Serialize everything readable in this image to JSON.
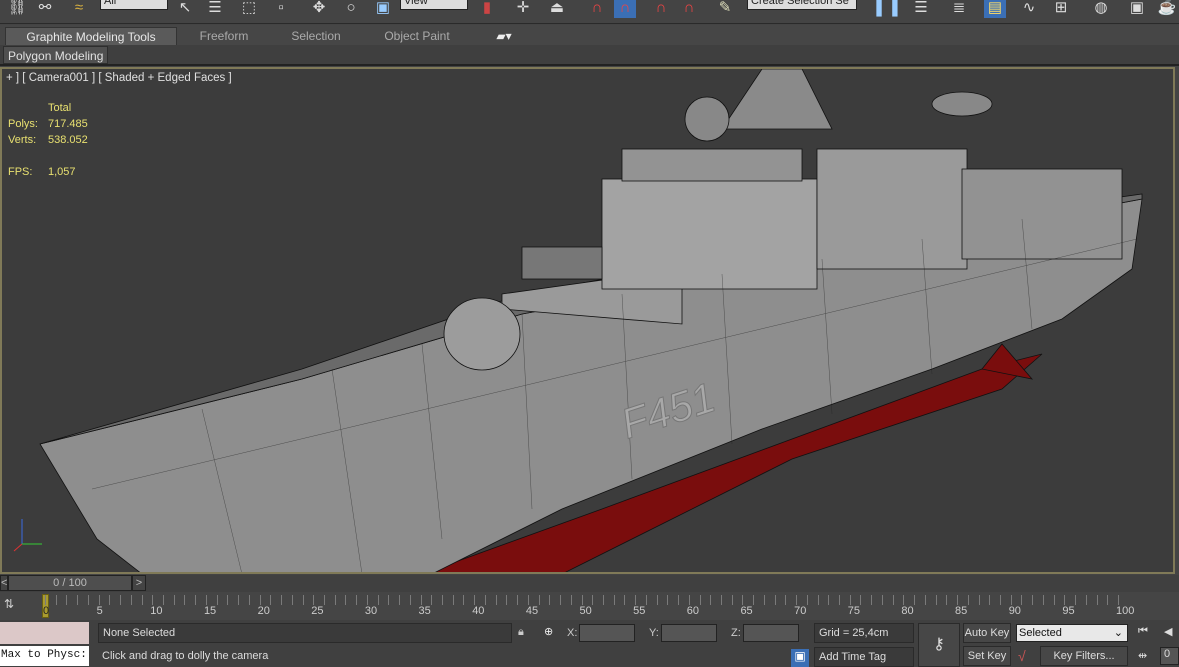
{
  "toolbar": {
    "selection_filter": "All",
    "ref_coord": "View",
    "named_selection": "Create Selection Se",
    "icons": [
      "link-icon",
      "unlink-icon",
      "bind-spacewarp-icon",
      "select-object-icon",
      "select-by-name-icon",
      "rect-region-icon",
      "window-crossing-icon",
      "move-icon",
      "rotate-icon",
      "scale-icon",
      "pivot-icon",
      "snap-icon",
      "angle-snap-icon",
      "percent-snap-icon",
      "spinner-snap-icon",
      "edit-named-sel-icon",
      "mirror-icon",
      "align-icon",
      "layer-icon",
      "scene-explorer-icon",
      "curve-editor-icon",
      "schematic-icon",
      "material-editor-icon",
      "render-setup-icon",
      "render-icon"
    ]
  },
  "ribbon": {
    "tabs": [
      "Graphite Modeling Tools",
      "Freeform",
      "Selection",
      "Object Paint"
    ],
    "active": 0,
    "panel": "Polygon Modeling"
  },
  "viewport": {
    "label": "+ ] [ Camera001 ] [ Shaded + Edged Faces ]",
    "stats": {
      "header": "Total",
      "polys_label": "Polys:",
      "polys": "717.485",
      "verts_label": "Verts:",
      "verts": "538.052",
      "fps_label": "FPS:",
      "fps": "1,057"
    },
    "hull_number": "F451",
    "colors": {
      "hull": "#8a8a8a",
      "antifouling": "#8b1010",
      "border": "#807a58"
    }
  },
  "timeline": {
    "frame": "0 / 100",
    "prev": "<",
    "next": ">",
    "current_frame": "0",
    "ticks": [
      "5",
      "10",
      "15",
      "20",
      "25",
      "30",
      "35",
      "40",
      "45",
      "50",
      "55",
      "60",
      "65",
      "70",
      "75",
      "80",
      "85",
      "90",
      "95",
      "100"
    ]
  },
  "status": {
    "maxscript": "Max to Physc:",
    "selection": "None Selected",
    "prompt": "Click and drag to dolly the camera",
    "x_label": "X:",
    "y_label": "Y:",
    "z_label": "Z:",
    "grid": "Grid = 25,4cm",
    "add_time_tag": "Add Time Tag",
    "auto_key": "Auto Key",
    "set_key": "Set Key",
    "key_mode": "Selected",
    "key_filters": "Key Filters...",
    "frame_value": "0"
  }
}
